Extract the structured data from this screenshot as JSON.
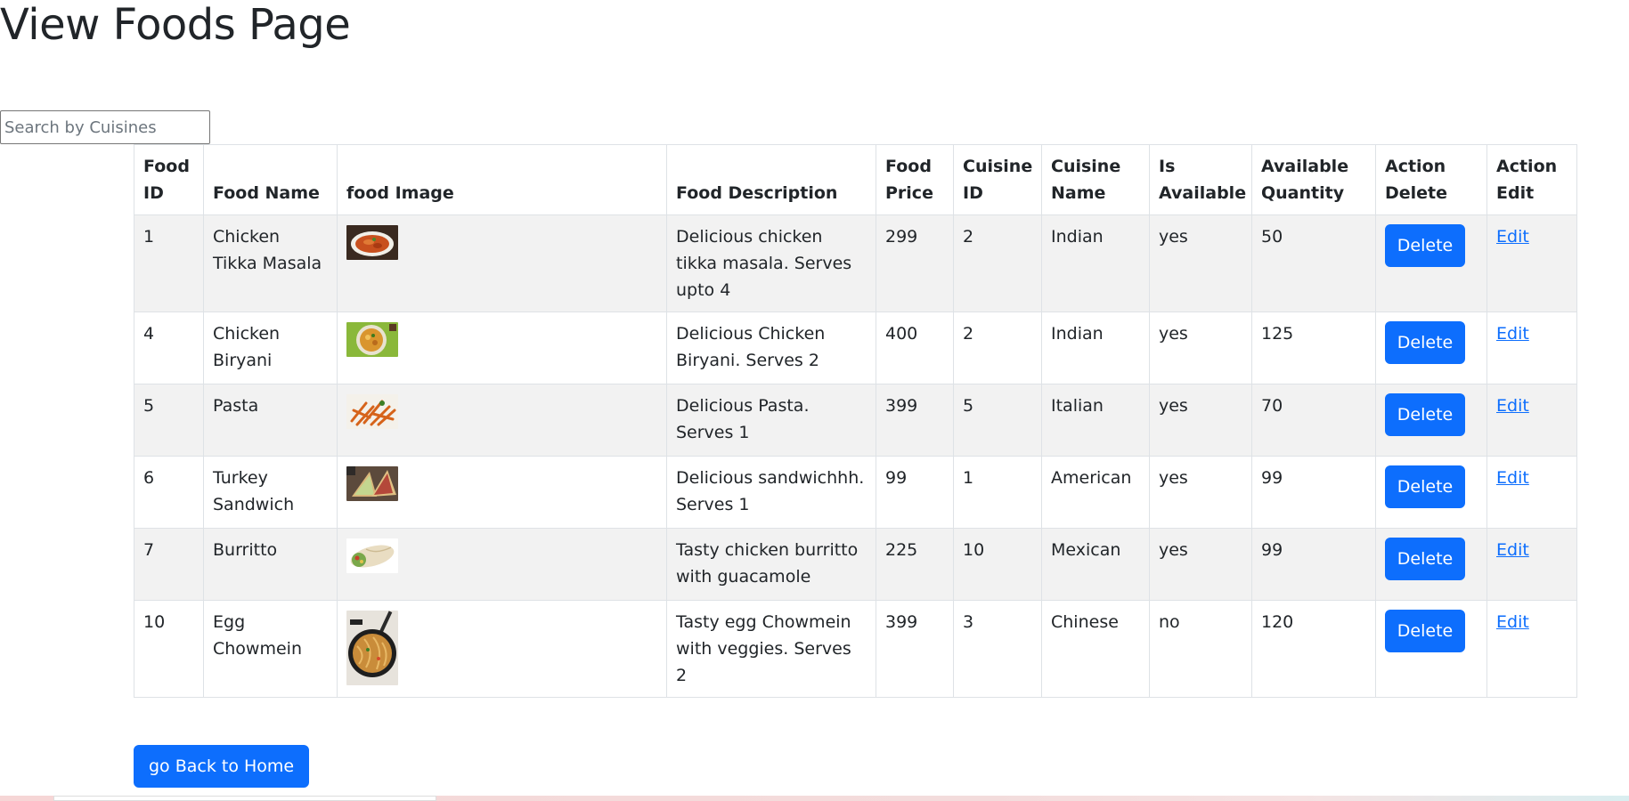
{
  "page": {
    "title": "View Foods Page",
    "back_button_label": "go Back to Home"
  },
  "search": {
    "placeholder": "Search by Cuisines",
    "value": ""
  },
  "table": {
    "headers": {
      "food_id": "Food ID",
      "food_name": "Food Name",
      "food_image": "food Image",
      "food_description": "Food Description",
      "food_price": "Food Price",
      "cuisine_id": "Cuisine ID",
      "cuisine_name": "Cuisine Name",
      "is_available": "Is Available",
      "available_quantity": "Available Quantity",
      "action_delete": "Action Delete",
      "action_edit": "Action Edit"
    },
    "rows": [
      {
        "food_id": "1",
        "food_name": "Chicken Tikka Masala",
        "image_icon": "curry-dish-photo",
        "food_description": "Delicious chicken tikka masala. Serves upto 4",
        "food_price": "299",
        "cuisine_id": "2",
        "cuisine_name": "Indian",
        "is_available": "yes",
        "available_quantity": "50",
        "delete_label": "Delete",
        "edit_label": "Edit"
      },
      {
        "food_id": "4",
        "food_name": "Chicken Biryani",
        "image_icon": "biryani-plate-photo",
        "food_description": "Delicious Chicken Biryani. Serves 2",
        "food_price": "400",
        "cuisine_id": "2",
        "cuisine_name": "Indian",
        "is_available": "yes",
        "available_quantity": "125",
        "delete_label": "Delete",
        "edit_label": "Edit"
      },
      {
        "food_id": "5",
        "food_name": "Pasta",
        "image_icon": "pasta-photo",
        "food_description": "Delicious Pasta. Serves 1",
        "food_price": "399",
        "cuisine_id": "5",
        "cuisine_name": "Italian",
        "is_available": "yes",
        "available_quantity": "70",
        "delete_label": "Delete",
        "edit_label": "Edit"
      },
      {
        "food_id": "6",
        "food_name": "Turkey Sandwich",
        "image_icon": "sandwich-photo",
        "food_description": "Delicious sandwichhh. Serves 1",
        "food_price": "99",
        "cuisine_id": "1",
        "cuisine_name": "American",
        "is_available": "yes",
        "available_quantity": "99",
        "delete_label": "Delete",
        "edit_label": "Edit"
      },
      {
        "food_id": "7",
        "food_name": "Burritto",
        "image_icon": "burrito-photo",
        "food_description": "Tasty chicken burritto with guacamole",
        "food_price": "225",
        "cuisine_id": "10",
        "cuisine_name": "Mexican",
        "is_available": "yes",
        "available_quantity": "99",
        "delete_label": "Delete",
        "edit_label": "Edit"
      },
      {
        "food_id": "10",
        "food_name": "Egg Chowmein",
        "image_icon": "chowmein-pan-photo",
        "food_description": "Tasty egg Chowmein with veggies. Serves 2",
        "food_price": "399",
        "cuisine_id": "3",
        "cuisine_name": "Chinese",
        "is_available": "no",
        "available_quantity": "120",
        "delete_label": "Delete",
        "edit_label": "Edit"
      }
    ]
  },
  "colors": {
    "primary": "#0d6efd",
    "stripe": "#f2f2f2",
    "border": "#dee2e6",
    "text": "#212529"
  }
}
